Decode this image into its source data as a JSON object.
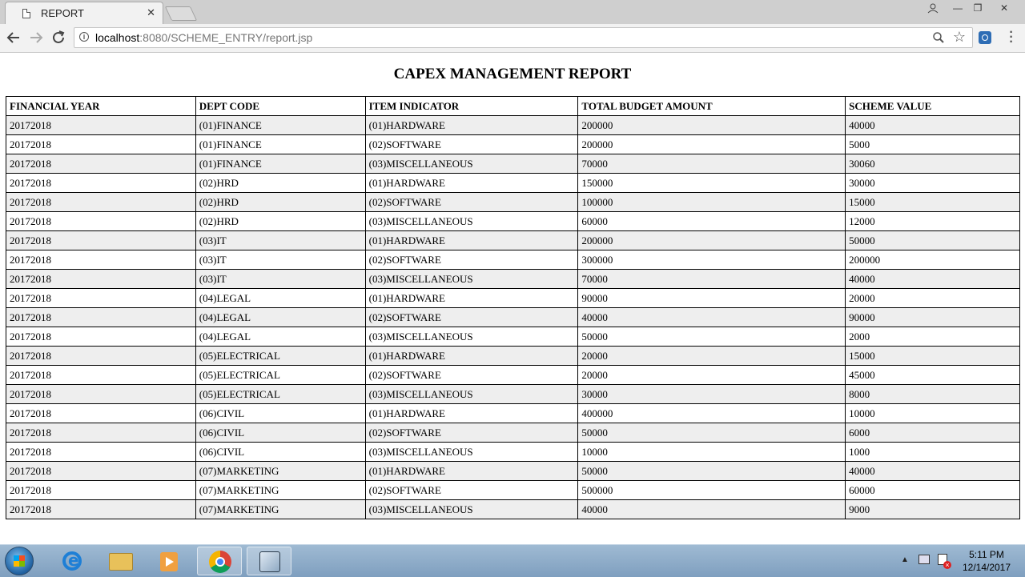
{
  "browser": {
    "tab_title": "REPORT",
    "close_glyph": "✕",
    "url_host": "localhost",
    "url_rest": ":8080/SCHEME_ENTRY/report.jsp",
    "window_controls": [
      "—",
      "❐",
      "✕"
    ]
  },
  "report": {
    "title": "CAPEX MANAGEMENT REPORT",
    "columns": [
      "FINANCIAL YEAR",
      "DEPT CODE",
      "ITEM INDICATOR",
      "TOTAL BUDGET AMOUNT",
      "SCHEME VALUE"
    ],
    "rows": [
      [
        "20172018",
        "(01)FINANCE",
        "(01)HARDWARE",
        "200000",
        "40000"
      ],
      [
        "20172018",
        "(01)FINANCE",
        "(02)SOFTWARE",
        "200000",
        "5000"
      ],
      [
        "20172018",
        "(01)FINANCE",
        "(03)MISCELLANEOUS",
        "70000",
        "30060"
      ],
      [
        "20172018",
        "(02)HRD",
        "(01)HARDWARE",
        "150000",
        "30000"
      ],
      [
        "20172018",
        "(02)HRD",
        "(02)SOFTWARE",
        "100000",
        "15000"
      ],
      [
        "20172018",
        "(02)HRD",
        "(03)MISCELLANEOUS",
        "60000",
        "12000"
      ],
      [
        "20172018",
        "(03)IT",
        "(01)HARDWARE",
        "200000",
        "50000"
      ],
      [
        "20172018",
        "(03)IT",
        "(02)SOFTWARE",
        "300000",
        "200000"
      ],
      [
        "20172018",
        "(03)IT",
        "(03)MISCELLANEOUS",
        "70000",
        "40000"
      ],
      [
        "20172018",
        "(04)LEGAL",
        "(01)HARDWARE",
        "90000",
        "20000"
      ],
      [
        "20172018",
        "(04)LEGAL",
        "(02)SOFTWARE",
        "40000",
        "90000"
      ],
      [
        "20172018",
        "(04)LEGAL",
        "(03)MISCELLANEOUS",
        "50000",
        "2000"
      ],
      [
        "20172018",
        "(05)ELECTRICAL",
        "(01)HARDWARE",
        "20000",
        "15000"
      ],
      [
        "20172018",
        "(05)ELECTRICAL",
        "(02)SOFTWARE",
        "20000",
        "45000"
      ],
      [
        "20172018",
        "(05)ELECTRICAL",
        "(03)MISCELLANEOUS",
        "30000",
        "8000"
      ],
      [
        "20172018",
        "(06)CIVIL",
        "(01)HARDWARE",
        "400000",
        "10000"
      ],
      [
        "20172018",
        "(06)CIVIL",
        "(02)SOFTWARE",
        "50000",
        "6000"
      ],
      [
        "20172018",
        "(06)CIVIL",
        "(03)MISCELLANEOUS",
        "10000",
        "1000"
      ],
      [
        "20172018",
        "(07)MARKETING",
        "(01)HARDWARE",
        "50000",
        "40000"
      ],
      [
        "20172018",
        "(07)MARKETING",
        "(02)SOFTWARE",
        "500000",
        "60000"
      ],
      [
        "20172018",
        "(07)MARKETING",
        "(03)MISCELLANEOUS",
        "40000",
        "9000"
      ]
    ]
  },
  "taskbar": {
    "apps": [
      "start-icon",
      "internet-explorer-icon",
      "file-explorer-icon",
      "media-player-icon",
      "chrome-icon",
      "virtualbox-icon"
    ],
    "time": "5:11 PM",
    "date": "12/14/2017"
  }
}
